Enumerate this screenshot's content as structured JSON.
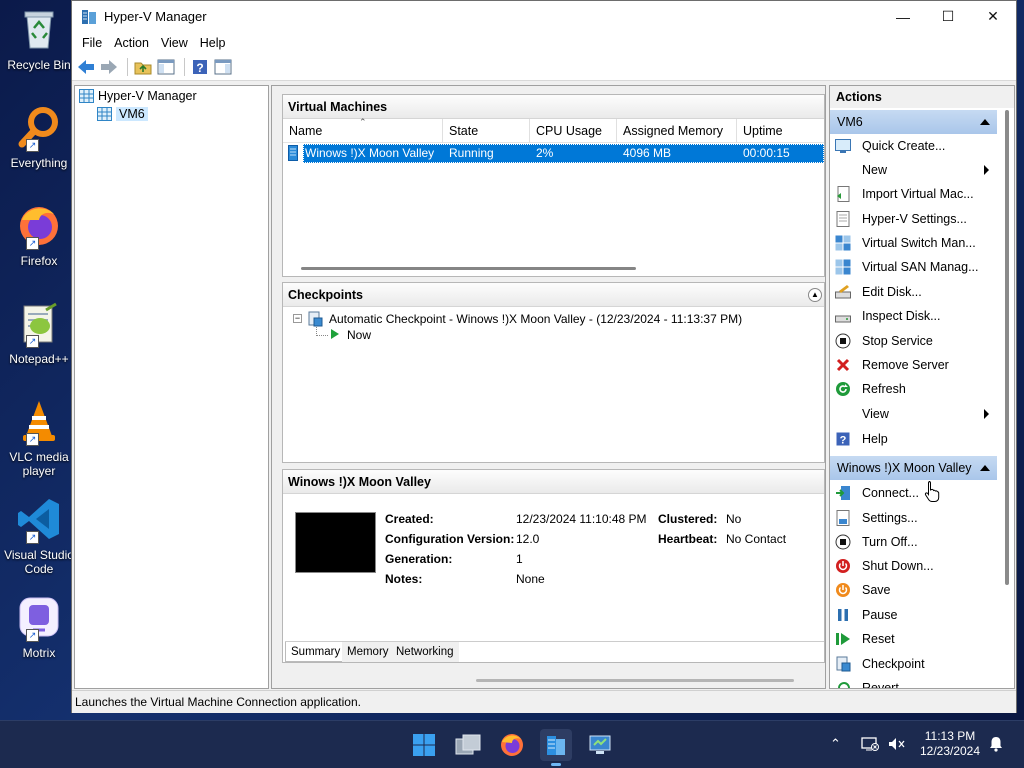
{
  "desktop": {
    "icons": [
      {
        "label": "Recycle Bin",
        "icon": "recycle-bin-icon"
      },
      {
        "label": "Everything",
        "icon": "everything-search-icon"
      },
      {
        "label": "Firefox",
        "icon": "firefox-icon"
      },
      {
        "label": "Notepad++",
        "icon": "notepad-plus-plus-icon"
      },
      {
        "label": "VLC media player",
        "icon": "vlc-icon"
      },
      {
        "label": "Visual Studio Code",
        "icon": "vscode-icon"
      },
      {
        "label": "Motrix",
        "icon": "motrix-icon"
      }
    ]
  },
  "window": {
    "title": "Hyper-V Manager",
    "controls": {
      "minimize": "—",
      "maximize": "☐",
      "close": "✕"
    },
    "menu": [
      "File",
      "Action",
      "View",
      "Help"
    ],
    "toolbar_icons": [
      "back-icon",
      "forward-icon",
      "up-folder-icon",
      "show-hide-console-tree-icon",
      "help-icon",
      "show-hide-action-pane-icon"
    ]
  },
  "tree": {
    "root": "Hyper-V Manager",
    "server": "VM6"
  },
  "virtual_machines": {
    "title": "Virtual Machines",
    "columns": [
      "Name",
      "State",
      "CPU Usage",
      "Assigned Memory",
      "Uptime"
    ],
    "rows": [
      {
        "name": "Winows !)X Moon Valley",
        "state": "Running",
        "cpu": "2%",
        "memory": "4096 MB",
        "uptime": "00:00:15"
      }
    ]
  },
  "checkpoints": {
    "title": "Checkpoints",
    "items": [
      {
        "label": "Automatic Checkpoint - Winows !)X Moon Valley - (12/23/2024 - 11:13:37 PM)"
      },
      {
        "label": "Now"
      }
    ]
  },
  "details": {
    "title": "Winows !)X Moon Valley",
    "fields_left": [
      {
        "key": "Created:",
        "value": "12/23/2024 11:10:48 PM"
      },
      {
        "key": "Configuration Version:",
        "value": "12.0"
      },
      {
        "key": "Generation:",
        "value": "1"
      },
      {
        "key": "Notes:",
        "value": "None"
      }
    ],
    "fields_right": [
      {
        "key": "Clustered:",
        "value": "No"
      },
      {
        "key": "Heartbeat:",
        "value": "No Contact"
      }
    ],
    "tabs": [
      "Summary",
      "Memory",
      "Networking"
    ],
    "active_tab": "Summary"
  },
  "actions": {
    "title": "Actions",
    "server_section": {
      "label": "VM6",
      "items": [
        {
          "label": "Quick Create...",
          "icon": "quick-create-icon"
        },
        {
          "label": "New",
          "icon": "",
          "submenu": true
        },
        {
          "label": "Import Virtual Mac...",
          "icon": "import-vm-icon"
        },
        {
          "label": "Hyper-V Settings...",
          "icon": "hyperv-settings-icon"
        },
        {
          "label": "Virtual Switch Man...",
          "icon": "virtual-switch-icon"
        },
        {
          "label": "Virtual SAN Manag...",
          "icon": "virtual-san-icon"
        },
        {
          "label": "Edit Disk...",
          "icon": "edit-disk-icon"
        },
        {
          "label": "Inspect Disk...",
          "icon": "inspect-disk-icon"
        },
        {
          "label": "Stop Service",
          "icon": "stop-service-icon"
        },
        {
          "label": "Remove Server",
          "icon": "remove-server-icon"
        },
        {
          "label": "Refresh",
          "icon": "refresh-icon"
        },
        {
          "label": "View",
          "icon": "",
          "submenu": true
        },
        {
          "label": "Help",
          "icon": "help-icon"
        }
      ]
    },
    "vm_section": {
      "label": "Winows !)X Moon Valley",
      "items": [
        {
          "label": "Connect...",
          "icon": "connect-icon"
        },
        {
          "label": "Settings...",
          "icon": "settings-icon"
        },
        {
          "label": "Turn Off...",
          "icon": "turn-off-icon"
        },
        {
          "label": "Shut Down...",
          "icon": "shut-down-icon"
        },
        {
          "label": "Save",
          "icon": "save-icon"
        },
        {
          "label": "Pause",
          "icon": "pause-icon"
        },
        {
          "label": "Reset",
          "icon": "reset-icon"
        },
        {
          "label": "Checkpoint",
          "icon": "checkpoint-icon"
        },
        {
          "label": "Revert...",
          "icon": "revert-icon"
        }
      ]
    }
  },
  "status_bar": "Launches the Virtual Machine Connection application.",
  "taskbar": {
    "apps": [
      "start-icon",
      "task-view-icon",
      "firefox-icon",
      "hyperv-manager-icon",
      "vm-connect-icon"
    ],
    "time": "11:13 PM",
    "date": "12/23/2024"
  },
  "colors": {
    "selection": "#0078d7",
    "section_header": "#b8d0ee",
    "taskbar": "#1c2a4f"
  }
}
